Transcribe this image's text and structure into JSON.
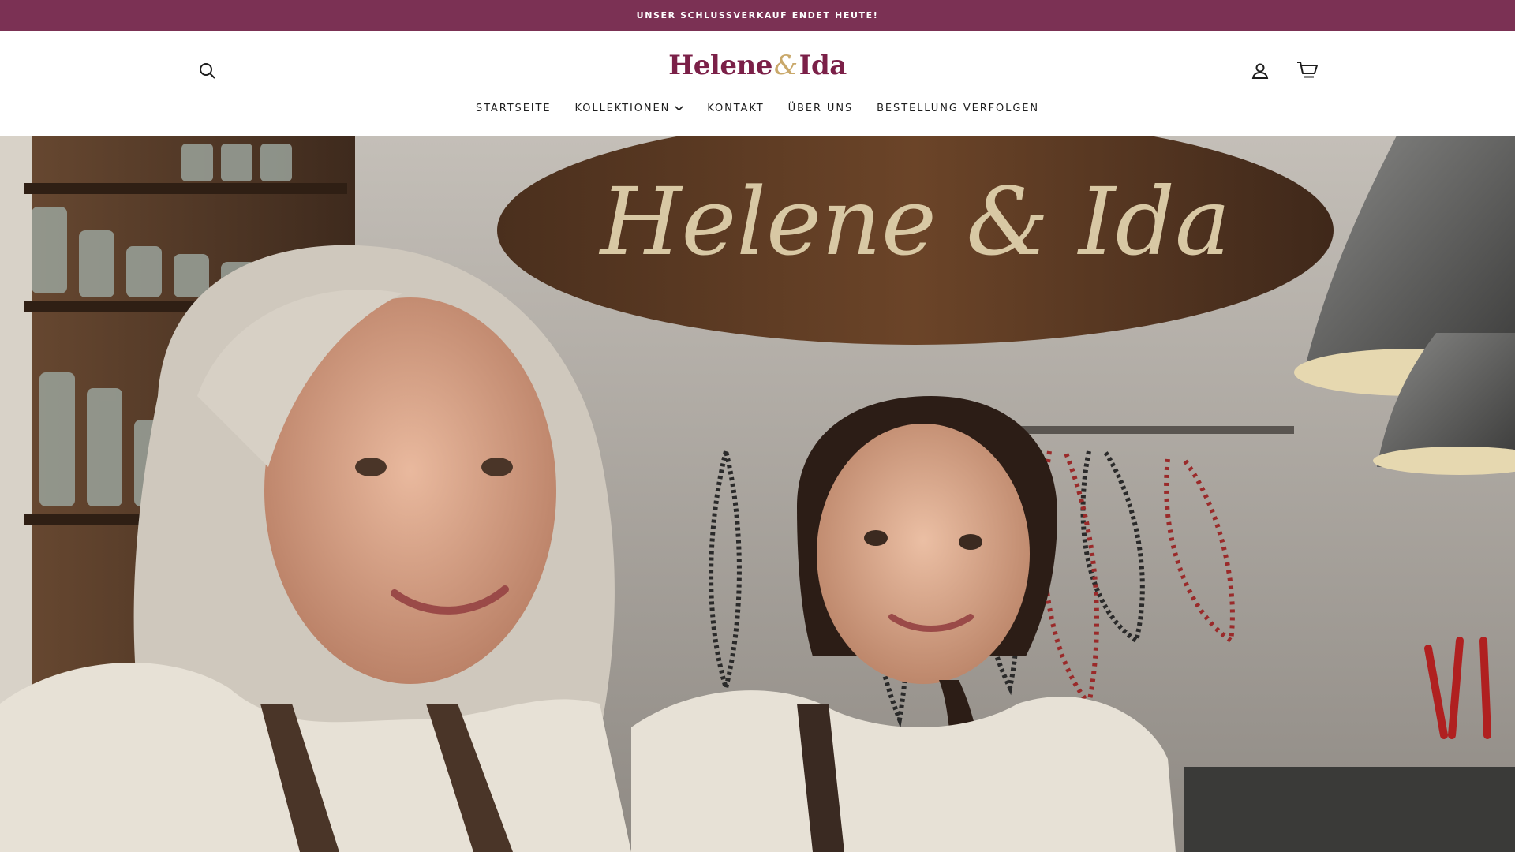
{
  "announcement": {
    "text": "UNSER SCHLUSSVERKAUF ENDET HEUTE!",
    "background": "#7b3154"
  },
  "header": {
    "logo": {
      "part1": "Helene",
      "amp": "&",
      "part2": "Ida",
      "color": "#7b2048",
      "amp_color": "#c9a86a"
    },
    "icons": {
      "search": "search-icon",
      "account": "user-icon",
      "cart": "cart-icon"
    }
  },
  "nav": {
    "items": [
      {
        "label": "STARTSEITE"
      },
      {
        "label": "KOLLEKTIONEN",
        "has_dropdown": true
      },
      {
        "label": "KONTAKT"
      },
      {
        "label": "ÜBER UNS"
      },
      {
        "label": "BESTELLUNG VERFOLGEN"
      }
    ]
  },
  "hero": {
    "sign": {
      "text": "Helene & Ida"
    }
  }
}
